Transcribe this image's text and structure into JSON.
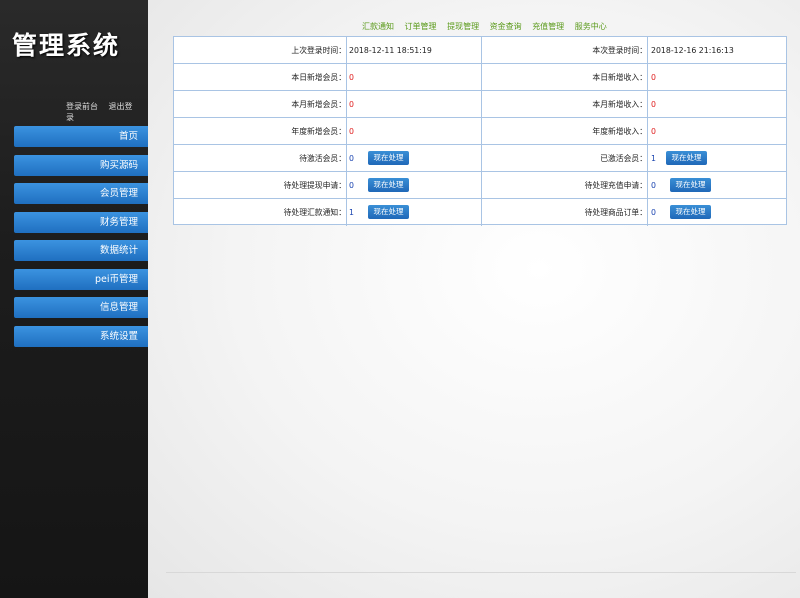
{
  "app": {
    "title": "管理系统"
  },
  "sidebar": {
    "links": [
      "登录前台",
      "退出登录"
    ],
    "menu": [
      "首页",
      "购买源码",
      "会员管理",
      "财务管理",
      "数据统计",
      "pei币管理",
      "信息管理",
      "系统设置"
    ]
  },
  "topnav": [
    "汇款通知",
    "订单管理",
    "提现管理",
    "资金查询",
    "充值管理",
    "服务中心"
  ],
  "rows": [
    {
      "l_label": "上次登录时间：",
      "l_value": "2018-12-11 18:51:19",
      "r_label": "本次登录时间：",
      "r_value": "2018-12-16 21:16:13"
    },
    {
      "l_label": "本日新增会员：",
      "l_value": "0",
      "r_label": "本日新增收入：",
      "r_value": "0"
    },
    {
      "l_label": "本月新增会员：",
      "l_value": "0",
      "r_label": "本月新增收入：",
      "r_value": "0"
    },
    {
      "l_label": "年度新增会员：",
      "l_value": "0",
      "r_label": "年度新增收入：",
      "r_value": "0"
    },
    {
      "l_label": "待激活会员：",
      "l_value": "0",
      "l_btn": "现在处理",
      "r_label": "已激活会员：",
      "r_value": "1",
      "r_btn": "现在处理"
    },
    {
      "l_label": "待处理提现申请：",
      "l_value": "0",
      "l_btn": "现在处理",
      "r_label": "待处理充值申请：",
      "r_value": "0",
      "r_btn": "现在处理"
    },
    {
      "l_label": "待处理汇款通知：",
      "l_value": "1",
      "l_btn": "现在处理",
      "r_label": "待处理商品订单：",
      "r_value": "0",
      "r_btn": "现在处理"
    }
  ],
  "colors": {
    "menu_blue": "#2a7fd4",
    "nav_green": "#5a9a1a",
    "value_red": "#e02020",
    "value_blue": "#1a44b0"
  }
}
